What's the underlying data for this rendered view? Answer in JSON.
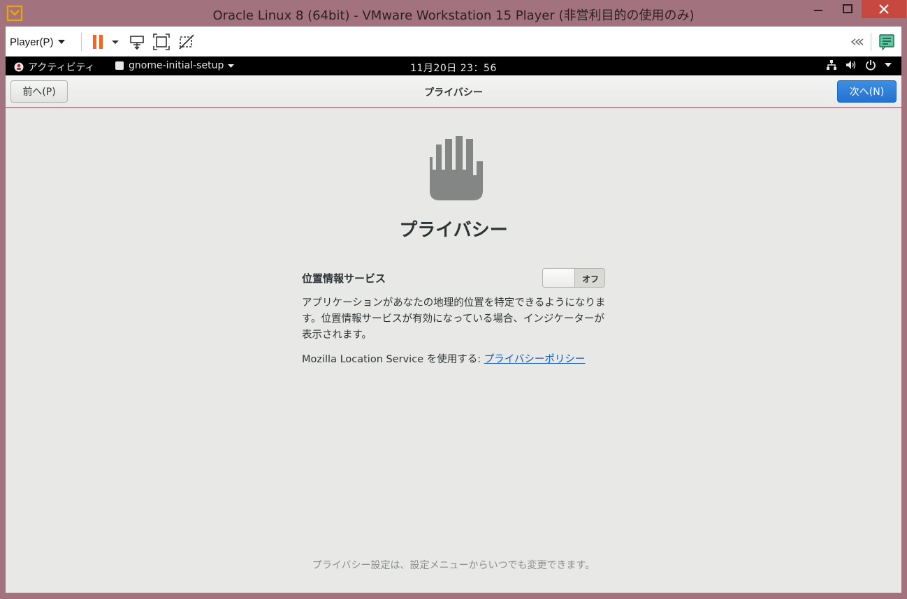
{
  "window": {
    "title": "Oracle Linux 8 (64bit) - VMware Workstation 15 Player (非営利目的の使用のみ)"
  },
  "vm_toolbar": {
    "player_menu_label": "Player(P)"
  },
  "gnome_bar": {
    "activities_label": "アクティビティ",
    "app_menu_label": "gnome-initial-setup",
    "clock": "11月20日  23：56"
  },
  "header": {
    "prev_label": "前へ(P)",
    "title": "プライバシー",
    "next_label": "次へ(N)"
  },
  "main": {
    "title": "プライバシー",
    "location_label": "位置情報サービス",
    "toggle_state": "オフ",
    "description": "アプリケーションがあなたの地理的位置を特定できるようになります。位置情報サービスが有効になっている場合、インジケーターが表示されます。",
    "mls_prefix": "Mozilla Location Service を使用する: ",
    "policy_link": "プライバシーポリシー",
    "footer_note": "プライバシー設定は、設定メニューからいつでも変更できます。"
  },
  "colors": {
    "accent": "#2771cf",
    "host_frame": "#a2737f",
    "close_button": "#c7483f",
    "pause_orange": "#f26522"
  }
}
